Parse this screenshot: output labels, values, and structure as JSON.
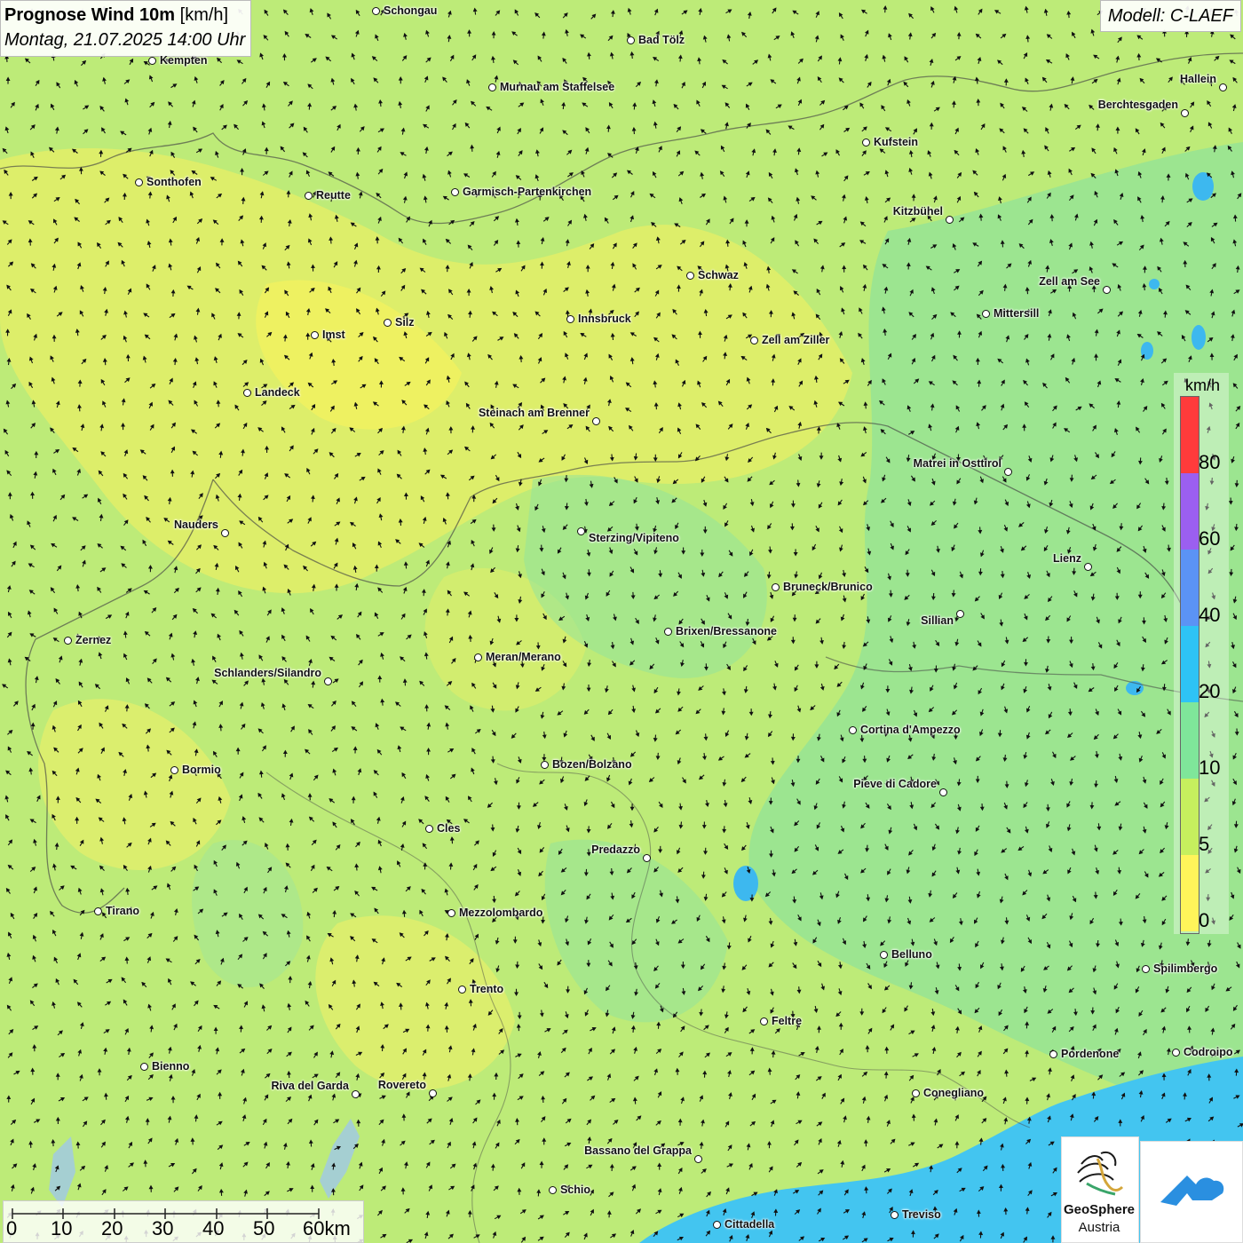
{
  "title": {
    "main": "Prognose Wind 10m",
    "unit": "[km/h]",
    "datetime": "Montag, 21.07.2025 14:00 Uhr"
  },
  "model": "Modell: C-LAEF",
  "legend": {
    "unit": "km/h",
    "ticks": [
      "80",
      "60",
      "40",
      "20",
      "10",
      "5",
      "0"
    ],
    "colors": [
      "#ff3b3b",
      "#9b5ff0",
      "#5b93f5",
      "#2ec3f5",
      "#7fe69a",
      "#c6ef5e",
      "#fff45a"
    ]
  },
  "colors": {
    "land_low": "#f7f26a",
    "land_mid": "#bfec7a",
    "land_high": "#86e39b",
    "sea": "#43c5f0"
  },
  "cities": [
    {
      "name": "Schongau"
    },
    {
      "name": "Bad Tölz"
    },
    {
      "name": "Kempten"
    },
    {
      "name": "Murnau am Staffelsee"
    },
    {
      "name": "Hallein"
    },
    {
      "name": "Berchtesgaden"
    },
    {
      "name": "Kufstein"
    },
    {
      "name": "Sonthofen"
    },
    {
      "name": "Reutte"
    },
    {
      "name": "Garmisch-Partenkirchen"
    },
    {
      "name": "Kitzbühel"
    },
    {
      "name": "Schwaz"
    },
    {
      "name": "Zell am See"
    },
    {
      "name": "Innsbruck"
    },
    {
      "name": "Mittersill"
    },
    {
      "name": "Silz"
    },
    {
      "name": "Imst"
    },
    {
      "name": "Zell am Ziller"
    },
    {
      "name": "Landeck"
    },
    {
      "name": "Steinach am Brenner"
    },
    {
      "name": "Matrei in Osttirol"
    },
    {
      "name": "Nauders"
    },
    {
      "name": "Sterzing/Vipiteno"
    },
    {
      "name": "Lienz"
    },
    {
      "name": "Bruneck/Brunico"
    },
    {
      "name": "Sillian"
    },
    {
      "name": "Brixen/Bressanone"
    },
    {
      "name": "Zernez"
    },
    {
      "name": "Meran/Merano"
    },
    {
      "name": "Schlanders/Silandro"
    },
    {
      "name": "Cortina d'Ampezzo"
    },
    {
      "name": "Bozen/Bolzano"
    },
    {
      "name": "Bormio"
    },
    {
      "name": "Pieve di Cadore"
    },
    {
      "name": "Cles"
    },
    {
      "name": "Predazzo"
    },
    {
      "name": "Tirano"
    },
    {
      "name": "Mezzolombardo"
    },
    {
      "name": "Belluno"
    },
    {
      "name": "Spilimbergo"
    },
    {
      "name": "Trento"
    },
    {
      "name": "Feltre"
    },
    {
      "name": "Pordenone"
    },
    {
      "name": "Codroipo"
    },
    {
      "name": "Bienno"
    },
    {
      "name": "Riva del Garda"
    },
    {
      "name": "Rovereto"
    },
    {
      "name": "Conegliano"
    },
    {
      "name": "Bassano del Grappa"
    },
    {
      "name": "Schio"
    },
    {
      "name": "Treviso"
    },
    {
      "name": "Cittadella"
    }
  ],
  "scale": {
    "labels": [
      "0",
      "10",
      "20",
      "30",
      "40",
      "50",
      "60km"
    ]
  },
  "logo": {
    "name": "GeoSphere",
    "sub": "Austria"
  }
}
